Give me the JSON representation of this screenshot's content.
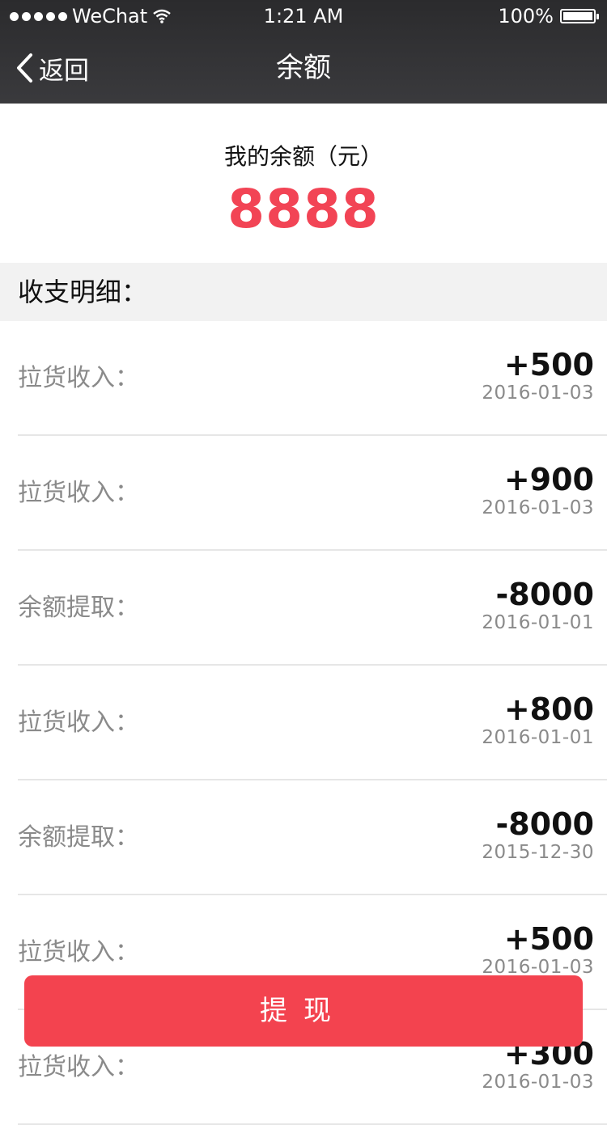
{
  "status_bar": {
    "carrier": "WeChat",
    "time": "1:21 AM",
    "battery": "100%"
  },
  "nav": {
    "back_label": "返回",
    "title": "余额"
  },
  "balance": {
    "label": "我的余额（元）",
    "amount": "8888"
  },
  "section_title": "收支明细：",
  "transactions": [
    {
      "type": "拉货收入：",
      "amount": "+500",
      "date": "2016-01-03"
    },
    {
      "type": "拉货收入：",
      "amount": "+900",
      "date": "2016-01-03"
    },
    {
      "type": "余额提取：",
      "amount": "-8000",
      "date": "2016-01-01"
    },
    {
      "type": "拉货收入：",
      "amount": "+800",
      "date": "2016-01-01"
    },
    {
      "type": "余额提取：",
      "amount": "-8000",
      "date": "2015-12-30"
    },
    {
      "type": "拉货收入：",
      "amount": "+500",
      "date": "2016-01-03"
    },
    {
      "type": "拉货收入：",
      "amount": "+300",
      "date": "2016-01-03"
    }
  ],
  "withdraw_label": "提现",
  "colors": {
    "accent": "#f24455",
    "button": "#f3434f",
    "header_bg": "#2b2b2d"
  },
  "icons": {
    "back": "chevron-left-icon",
    "wifi": "wifi-icon",
    "battery": "battery-icon",
    "signal": "signal-dots-icon"
  }
}
